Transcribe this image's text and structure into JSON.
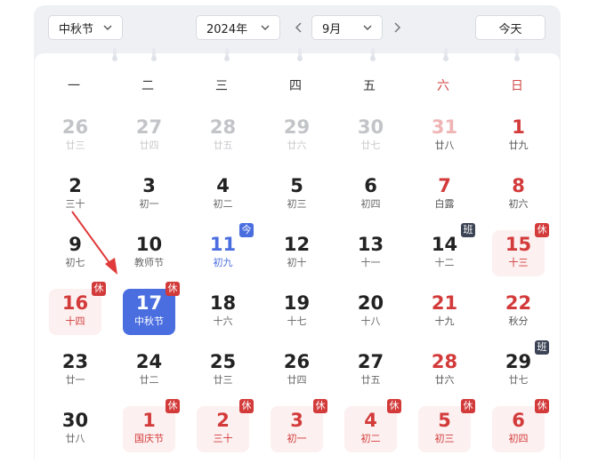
{
  "toolbar": {
    "festival_select": "中秋节",
    "year_select": "2024年",
    "month_select": "9月",
    "today_button": "今天"
  },
  "weekdays": [
    "一",
    "二",
    "三",
    "四",
    "五",
    "六",
    "日"
  ],
  "colors": {
    "accent": "#4a6ee0",
    "holiday_red": "#d33a3a",
    "workday_badge": "#3d4455"
  },
  "calendar": {
    "rows": [
      [
        {
          "num": "26",
          "lunar": "廿三",
          "other": true
        },
        {
          "num": "27",
          "lunar": "廿四",
          "other": true
        },
        {
          "num": "28",
          "lunar": "廿五",
          "other": true
        },
        {
          "num": "29",
          "lunar": "廿六",
          "other": true
        },
        {
          "num": "30",
          "lunar": "廿七",
          "other": true
        },
        {
          "num": "31",
          "lunar": "廿八",
          "other": true,
          "weekend": true
        },
        {
          "num": "1",
          "lunar": "廿九",
          "weekend": true
        }
      ],
      [
        {
          "num": "2",
          "lunar": "三十"
        },
        {
          "num": "3",
          "lunar": "初一"
        },
        {
          "num": "4",
          "lunar": "初二"
        },
        {
          "num": "5",
          "lunar": "初三"
        },
        {
          "num": "6",
          "lunar": "初四"
        },
        {
          "num": "7",
          "lunar": "白露",
          "weekend": true
        },
        {
          "num": "8",
          "lunar": "初六",
          "weekend": true
        }
      ],
      [
        {
          "num": "9",
          "lunar": "初七"
        },
        {
          "num": "10",
          "lunar": "教师节"
        },
        {
          "num": "11",
          "lunar": "初九",
          "today": true,
          "badge": "今"
        },
        {
          "num": "12",
          "lunar": "初十"
        },
        {
          "num": "13",
          "lunar": "十一"
        },
        {
          "num": "14",
          "lunar": "十二",
          "badge": "班"
        },
        {
          "num": "15",
          "lunar": "十三",
          "holiday": true,
          "badge": "休"
        }
      ],
      [
        {
          "num": "16",
          "lunar": "十四",
          "holiday": true,
          "badge": "休"
        },
        {
          "num": "17",
          "lunar": "中秋节",
          "selected": true,
          "badge": "休"
        },
        {
          "num": "18",
          "lunar": "十六"
        },
        {
          "num": "19",
          "lunar": "十七"
        },
        {
          "num": "20",
          "lunar": "十八"
        },
        {
          "num": "21",
          "lunar": "十九",
          "weekend": true
        },
        {
          "num": "22",
          "lunar": "秋分",
          "weekend": true
        }
      ],
      [
        {
          "num": "23",
          "lunar": "廿一"
        },
        {
          "num": "24",
          "lunar": "廿二"
        },
        {
          "num": "25",
          "lunar": "廿三"
        },
        {
          "num": "26",
          "lunar": "廿四"
        },
        {
          "num": "27",
          "lunar": "廿五"
        },
        {
          "num": "28",
          "lunar": "廿六",
          "weekend": true
        },
        {
          "num": "29",
          "lunar": "廿七",
          "badge": "班"
        }
      ],
      [
        {
          "num": "30",
          "lunar": "廿八"
        },
        {
          "num": "1",
          "lunar": "国庆节",
          "holiday": true,
          "badge": "休"
        },
        {
          "num": "2",
          "lunar": "三十",
          "holiday": true,
          "badge": "休"
        },
        {
          "num": "3",
          "lunar": "初一",
          "holiday": true,
          "badge": "休"
        },
        {
          "num": "4",
          "lunar": "初二",
          "holiday": true,
          "badge": "休"
        },
        {
          "num": "5",
          "lunar": "初三",
          "holiday": true,
          "badge": "休"
        },
        {
          "num": "6",
          "lunar": "初四",
          "holiday": true,
          "badge": "休"
        }
      ]
    ]
  }
}
